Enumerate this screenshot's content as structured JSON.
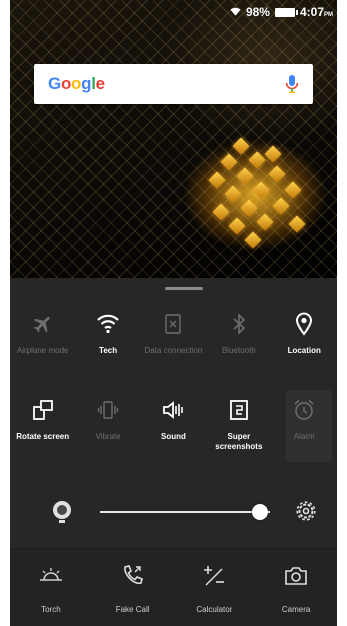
{
  "status_bar": {
    "battery_percent": "98%",
    "time": "4:07",
    "time_suffix": "PM"
  },
  "search": {
    "logo_letters": [
      "G",
      "o",
      "o",
      "g",
      "l",
      "e"
    ],
    "mic_icon": "mic-icon"
  },
  "toggles_row1": [
    {
      "label": "Airplane mode",
      "icon": "airplane-icon",
      "state": "off"
    },
    {
      "label": "Tech",
      "icon": "wifi-icon",
      "state": "on"
    },
    {
      "label": "Data connection",
      "icon": "data-connection-icon",
      "state": "off"
    },
    {
      "label": "Bluetooth",
      "icon": "bluetooth-icon",
      "state": "off"
    },
    {
      "label": "Location",
      "icon": "location-icon",
      "state": "on"
    }
  ],
  "toggles_row2": [
    {
      "label": "Rotate screen",
      "icon": "rotate-icon",
      "state": "on"
    },
    {
      "label": "Vibrate",
      "icon": "vibrate-icon",
      "state": "off"
    },
    {
      "label": "Sound",
      "icon": "sound-icon",
      "state": "on"
    },
    {
      "label": "Super screenshots",
      "icon": "screenshot-icon",
      "state": "on"
    },
    {
      "label": "Alarm",
      "icon": "alarm-icon",
      "state": "off"
    }
  ],
  "brightness": {
    "auto_icon": "auto-brightness-icon",
    "level": 0.94,
    "settings_icon": "gear-icon"
  },
  "shortcuts": [
    {
      "label": "Torch",
      "icon": "torch-icon"
    },
    {
      "label": "Fake Call",
      "icon": "fake-call-icon"
    },
    {
      "label": "Calculator",
      "icon": "calculator-icon"
    },
    {
      "label": "Camera",
      "icon": "camera-icon"
    }
  ],
  "colors": {
    "panel_bg": "#272727",
    "active": "#ffffff",
    "inactive": "#6e6e6e"
  }
}
